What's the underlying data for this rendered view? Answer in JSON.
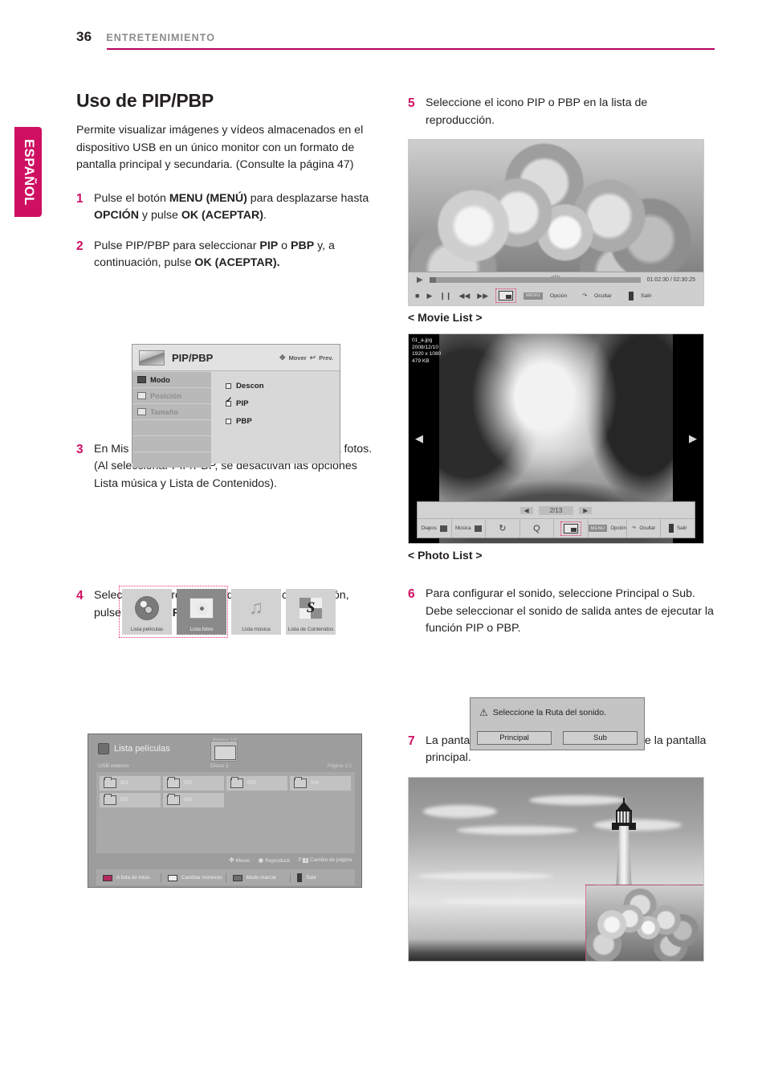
{
  "header": {
    "page_number": "36",
    "chapter": "ENTRETENIMIENTO"
  },
  "language_tab": {
    "label": "ESPAÑOL"
  },
  "left": {
    "title": "Uso de PIP/PBP",
    "intro": "Permite visualizar imágenes y vídeos almacenados en el dispositivo USB en un único monitor con un formato de pantalla principal y secundaria. (Consulte la página 47)",
    "steps": [
      {
        "num": "1",
        "html": "Pulse el botón <b>MENU (MENÚ)</b> para desplazarse hasta <b>OPCIÓN</b> y pulse <b>OK (ACEPTAR)</b>."
      },
      {
        "num": "2",
        "html": "Pulse PIP/PBP para seleccionar <b>PIP</b> o <b>PBP</b> y, a continuación, pulse <b>OK (ACEPTAR).</b>"
      },
      {
        "num": "3",
        "html": "En Mis medios, seleccione Lista películas o Lista fotos. (Al seleccionar PIP/PBP, se desactivan las opciones Lista música y Lista de Contenidos)."
      },
      {
        "num": "4",
        "html": "Seleccione el archivo que desee y, a continuación, pulse <b>OK (ACEPTAR)</b>."
      }
    ]
  },
  "right": {
    "steps": [
      {
        "num": "5",
        "html": "Seleccione el icono PIP o PBP en la lista de reproducción."
      },
      {
        "num": "6",
        "html": "Para configurar el sonido, seleccione Principal o Sub. Debe seleccionar el sonido de salida antes de ejecutar la función PIP o PBP."
      },
      {
        "num": "7",
        "html": "La pantalla secundaria se muestra dentro de la pantalla principal."
      }
    ],
    "caption_movie": "< Movie List >",
    "caption_photo": "< Photo List >"
  },
  "osd_pip": {
    "title": "PIP/PBP",
    "hint_move": "Mover",
    "hint_prev": "Prev.",
    "menu_items": [
      {
        "label": "Modo",
        "selected": true
      },
      {
        "label": "Posición",
        "selected": false
      },
      {
        "label": "Tamaño",
        "selected": false
      }
    ],
    "options": [
      {
        "label": "Descon",
        "checked": false
      },
      {
        "label": "PIP",
        "checked": true
      },
      {
        "label": "PBP",
        "checked": false
      }
    ]
  },
  "media_row": {
    "items": [
      {
        "label": "Lista películas",
        "icon": "film-reel-icon",
        "active": false
      },
      {
        "label": "Lista fotos",
        "icon": "photo-icon",
        "active": true
      },
      {
        "label": "Lista música",
        "icon": "music-note-icon",
        "active": false
      },
      {
        "label": "Lista de Contenidos",
        "icon": "supersign-icon",
        "active": false
      }
    ]
  },
  "movie_list_osd": {
    "title": "Lista películas",
    "page_top": "Página 1/1",
    "source": "USB externo",
    "disc": "Disco 1",
    "page_right": "Página 1/1",
    "folders": [
      "001",
      "002",
      "003",
      "004",
      "005",
      "006"
    ],
    "hints": [
      {
        "label": "Mover",
        "glyph": "dpad-icon"
      },
      {
        "label": "Reproducir",
        "glyph": "ok-icon"
      },
      {
        "label": "Cambio de página",
        "glyph": "p-key-icon",
        "prefix": "P"
      }
    ],
    "keys": [
      {
        "label": "A lista de fotos",
        "color": "#b32a5e"
      },
      {
        "label": "Cambiar números",
        "color": "#e8e8e8"
      },
      {
        "label": "Modo marcar",
        "color": "#6d6d6d"
      },
      {
        "label": "Salir",
        "color": "#2e2e2e"
      }
    ]
  },
  "movie_player": {
    "time": "01:02:30 / 02:30:25",
    "buttons": [
      {
        "name": "stop",
        "glyph": "■"
      },
      {
        "name": "play",
        "glyph": "▶"
      },
      {
        "name": "pause",
        "glyph": "❙❙"
      },
      {
        "name": "rewind",
        "glyph": "◀◀"
      },
      {
        "name": "forward",
        "glyph": "▶▶"
      }
    ],
    "pip_button": "pip-icon",
    "menu_chip": "MENU",
    "option_label": "Opción",
    "hide_label": "Ocultar",
    "exit_label": "Salir"
  },
  "photo_viewer": {
    "file_name": "01_a.jpg",
    "date": "2008/12/10",
    "resolution": "1920 x 1080",
    "size": "479 KB",
    "page": "2/13",
    "prev_arrow": "◀",
    "next_arrow": "▶",
    "keys": [
      {
        "label": "Diapos",
        "type": "dropdown"
      },
      {
        "label": "Música",
        "type": "dropdown"
      },
      {
        "label": "",
        "type": "rotate",
        "glyph": "↻"
      },
      {
        "label": "",
        "type": "zoom",
        "glyph": "Q"
      },
      {
        "label": "",
        "type": "pip",
        "glyph": "pip-icon"
      },
      {
        "label": "Opción",
        "type": "menu",
        "chip": "MENU"
      },
      {
        "label": "Ocultar",
        "type": "hide"
      },
      {
        "label": "Salir",
        "type": "exit"
      }
    ]
  },
  "sound_dialog": {
    "message": "Seleccione la Ruta del sonido.",
    "warn_icon": "warning-triangle-icon",
    "buttons": [
      "Principal",
      "Sub"
    ]
  },
  "colors": {
    "accent": "#cf0f62",
    "rule": "#b4045f",
    "dotted_highlight": "#e8316f",
    "header_gray": "#8c8c8c",
    "body_text": "#231f20"
  }
}
